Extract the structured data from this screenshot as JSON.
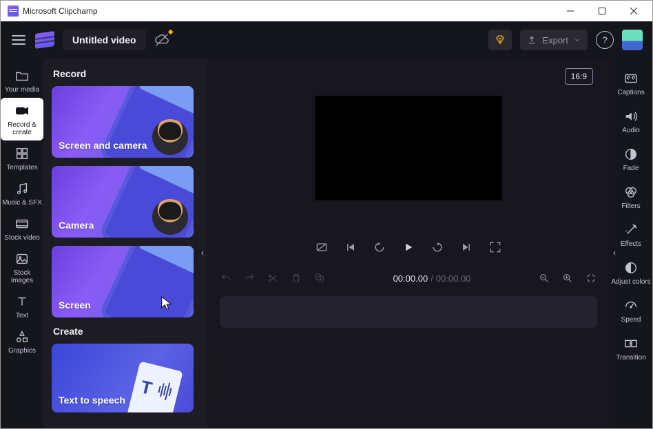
{
  "window": {
    "title": "Microsoft Clipchamp"
  },
  "topbar": {
    "project_name": "Untitled video",
    "export_label": "Export",
    "help_glyph": "?"
  },
  "left_rail": {
    "items": [
      {
        "icon": "folder",
        "label": "Your media"
      },
      {
        "icon": "camera",
        "label": "Record & create"
      },
      {
        "icon": "templates",
        "label": "Templates"
      },
      {
        "icon": "music",
        "label": "Music & SFX"
      },
      {
        "icon": "stockvid",
        "label": "Stock video"
      },
      {
        "icon": "stockimg",
        "label": "Stock images"
      },
      {
        "icon": "text",
        "label": "Text"
      },
      {
        "icon": "graphics",
        "label": "Graphics"
      }
    ],
    "active_index": 1
  },
  "panel": {
    "section_record": "Record",
    "section_create": "Create",
    "cards": {
      "screen_camera": "Screen and camera",
      "camera": "Camera",
      "screen": "Screen",
      "tts": "Text to speech"
    }
  },
  "preview": {
    "aspect": "16:9"
  },
  "timeline": {
    "current": "00:00.00",
    "separator": "/",
    "duration": "00:00.00"
  },
  "right_rail": {
    "items": [
      {
        "icon": "cc",
        "label": "Captions"
      },
      {
        "icon": "audio",
        "label": "Audio"
      },
      {
        "icon": "fade",
        "label": "Fade"
      },
      {
        "icon": "filters",
        "label": "Filters"
      },
      {
        "icon": "effects",
        "label": "Effects"
      },
      {
        "icon": "adjust",
        "label": "Adjust colors"
      },
      {
        "icon": "speed",
        "label": "Speed"
      },
      {
        "icon": "transition",
        "label": "Transition"
      }
    ]
  }
}
